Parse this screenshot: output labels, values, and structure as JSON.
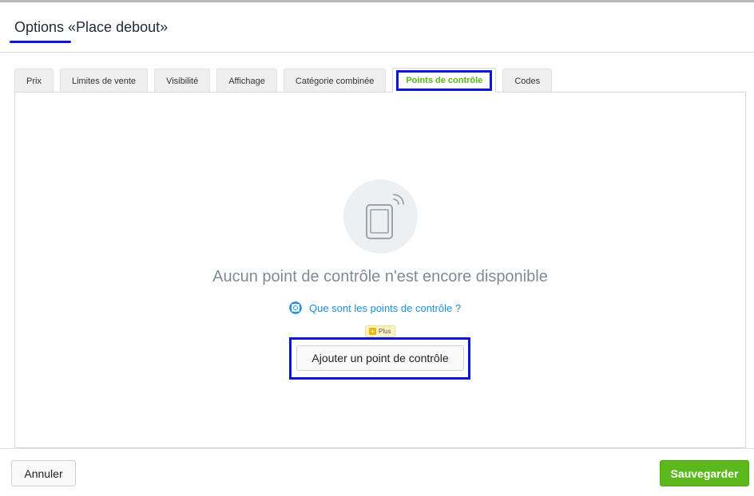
{
  "modal": {
    "title": "Options «Place debout»"
  },
  "tabs": [
    {
      "label": "Prix"
    },
    {
      "label": "Limites de vente"
    },
    {
      "label": "Visibilité"
    },
    {
      "label": "Affichage"
    },
    {
      "label": "Catégorie combinée"
    },
    {
      "label": "Points de contrôle"
    },
    {
      "label": "Codes"
    }
  ],
  "active_tab": "Points de contrôle",
  "empty_state": {
    "icon": "phone-signal-icon",
    "message": "Aucun point de contrôle n'est encore disponible",
    "help_link": "Que sont les points de contrôle ?",
    "help_icon": "lifebuoy-icon",
    "badge_label": "Plus",
    "add_button": "Ajouter un point de contrôle"
  },
  "footer": {
    "cancel_label": "Annuler",
    "save_label": "Sauvegarder"
  },
  "colors": {
    "accent_green": "#5cb81c",
    "link_blue": "#1c8ee0",
    "highlight_blue": "#0c16d6"
  }
}
